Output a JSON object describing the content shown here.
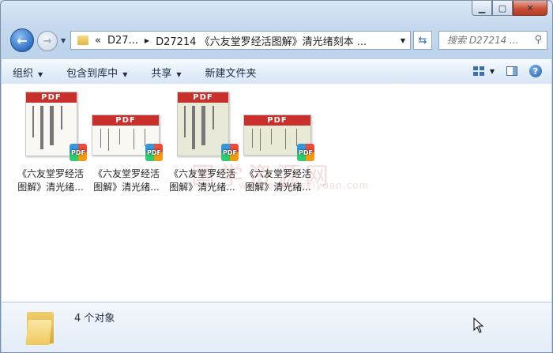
{
  "nav": {
    "back_icon": "back-arrow-icon",
    "forward_icon": "forward-arrow-icon",
    "breadcrumb_prefix": "«",
    "breadcrumb": [
      "D27...",
      "D27214 《六友堂罗经活图解》清光绪刻本 ..."
    ],
    "search_placeholder": "搜索 D27214 ..."
  },
  "toolbar": {
    "organize": "组织",
    "include_in_library": "包含到库中",
    "share": "共享",
    "new_folder": "新建文件夹"
  },
  "files": [
    {
      "name": "《六友堂罗经活图解》清光绪...",
      "label": "PDF",
      "style": "tall"
    },
    {
      "name": "《六友堂罗经活图解》清光绪...",
      "label": "PDF",
      "style": "wide"
    },
    {
      "name": "《六友堂罗经活图解》清光绪...",
      "label": "PDF",
      "style": "tall-green"
    },
    {
      "name": "《六友堂罗经活图解》清光绪...",
      "label": "PDF",
      "style": "wide-green"
    }
  ],
  "watermark": {
    "main": "国学资源网",
    "url": "www.guoxueziyuan.com"
  },
  "status": {
    "count": "4 个对象"
  },
  "colors": {
    "pdf_red": "#c9302c",
    "close_red": "#c9503a",
    "window_blue": "#c6d9ee"
  }
}
